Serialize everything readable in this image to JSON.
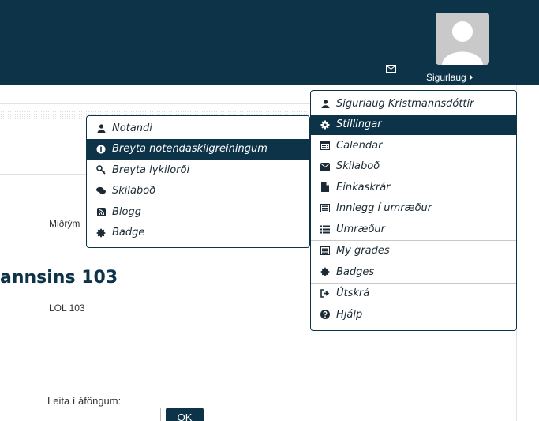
{
  "header": {
    "user_name": "Sigurlaug",
    "icons": [
      "envelope-icon",
      "avatar-silhouette",
      "caret-right-icon"
    ]
  },
  "content": {
    "field_label": "Miðrým",
    "course_title": "annsins 103",
    "course_code": "LOL 103",
    "search_label": "Leita í áföngum:",
    "ok_label": "OK"
  },
  "user_menu": {
    "items": [
      {
        "label": "Sigurlaug Kristmannsdóttir",
        "icon": "user-icon"
      },
      {
        "label": "Stillingar",
        "icon": "gear-icon",
        "active": true
      },
      {
        "label": "Calendar",
        "icon": "calendar-icon"
      },
      {
        "label": "Skilaboð",
        "icon": "envelope-icon"
      },
      {
        "label": "Einkaskrár",
        "icon": "file-icon"
      },
      {
        "label": "Innlegg í umræður",
        "icon": "list-box-icon"
      },
      {
        "label": "Umræður",
        "icon": "list-icon"
      },
      {
        "label": "My grades",
        "icon": "list-box-icon"
      },
      {
        "label": "Badges",
        "icon": "badge-icon"
      },
      {
        "label": "Útskrá",
        "icon": "sign-out-icon"
      },
      {
        "label": "Hjálp",
        "icon": "question-circle-icon"
      }
    ]
  },
  "settings_submenu": {
    "items": [
      {
        "label": "Notandi",
        "icon": "user-icon"
      },
      {
        "label": "Breyta notendaskilgreiningum",
        "icon": "info-circle-icon",
        "active": true
      },
      {
        "label": "Breyta lykilorði",
        "icon": "key-icon"
      },
      {
        "label": "Skilaboð",
        "icon": "comments-icon"
      },
      {
        "label": "Blogg",
        "icon": "rss-icon"
      },
      {
        "label": "Badge",
        "icon": "badge-icon"
      }
    ]
  },
  "colors": {
    "header_bg": "#0d3349",
    "active_bg": "#0d3349",
    "border": "#0d3349"
  }
}
